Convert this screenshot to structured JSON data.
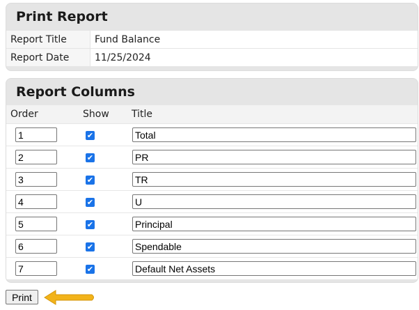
{
  "print_report": {
    "heading": "Print Report",
    "fields": [
      {
        "label": "Report Title",
        "value": "Fund Balance"
      },
      {
        "label": "Report Date",
        "value": "11/25/2024"
      }
    ]
  },
  "report_columns": {
    "heading": "Report Columns",
    "headers": {
      "order": "Order",
      "show": "Show",
      "title": "Title"
    },
    "rows": [
      {
        "order": "1",
        "show": true,
        "title": "Total"
      },
      {
        "order": "2",
        "show": true,
        "title": "PR"
      },
      {
        "order": "3",
        "show": true,
        "title": "TR"
      },
      {
        "order": "4",
        "show": true,
        "title": "U"
      },
      {
        "order": "5",
        "show": true,
        "title": "Principal"
      },
      {
        "order": "6",
        "show": true,
        "title": "Spendable"
      },
      {
        "order": "7",
        "show": true,
        "title": "Default Net Assets"
      }
    ]
  },
  "actions": {
    "print_label": "Print"
  },
  "colors": {
    "arrow": "#f2b31a",
    "checkbox": "#1a73e8",
    "panel": "#e5e5e5"
  },
  "icons": {
    "pointer": "arrow-left-icon",
    "check": "checkmark-icon"
  }
}
